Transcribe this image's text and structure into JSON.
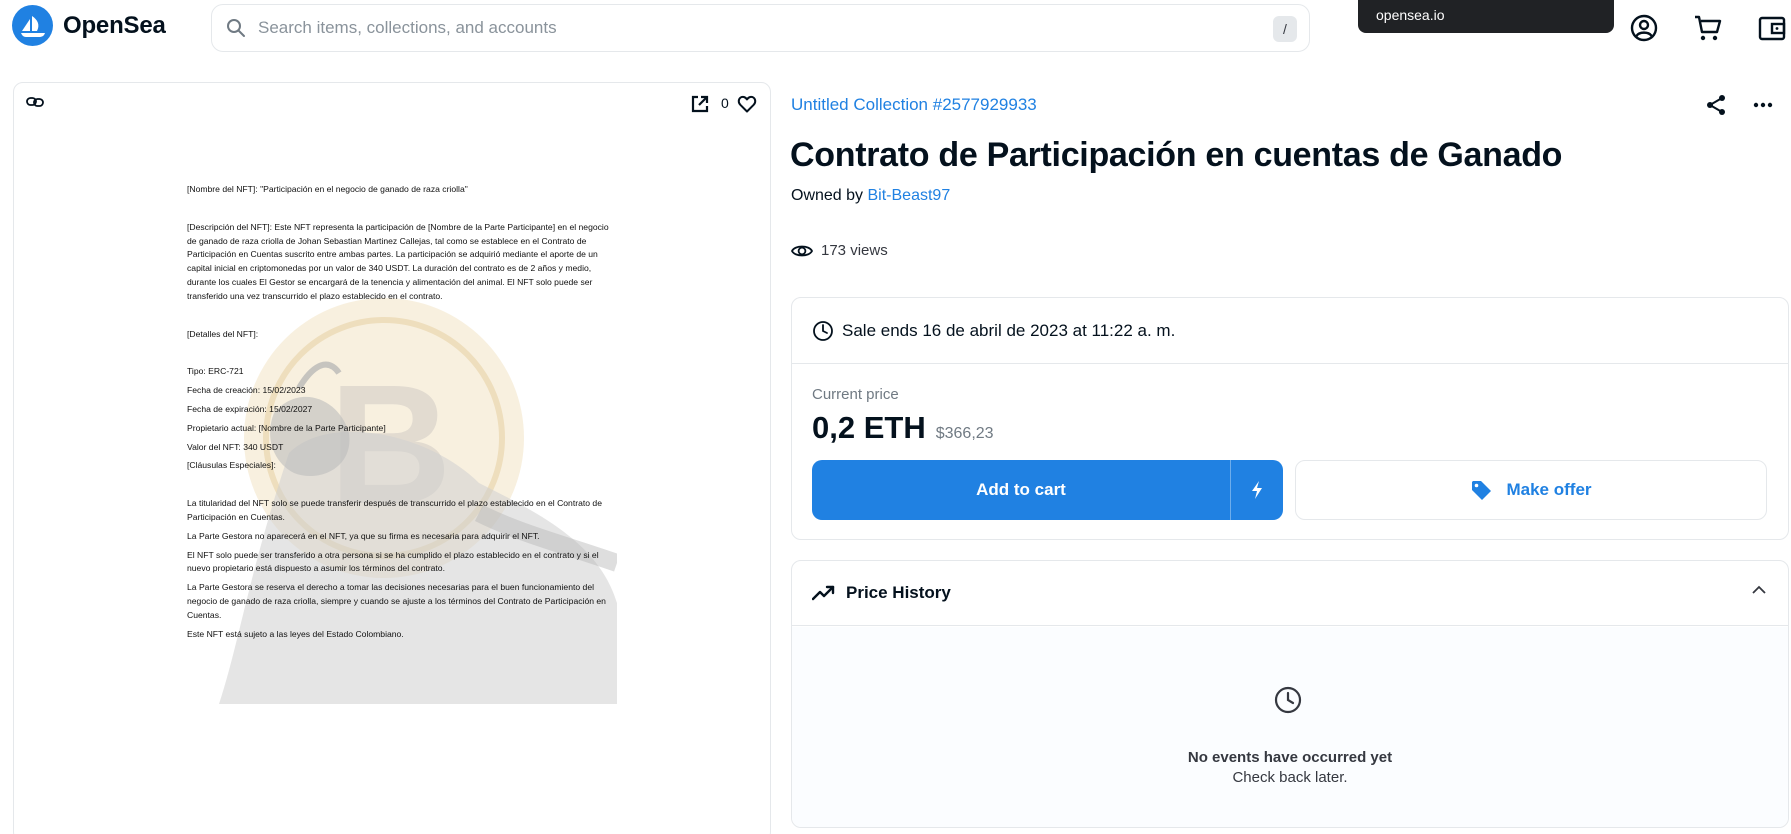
{
  "header": {
    "brand": "OpenSea",
    "search_placeholder": "Search items, collections, and accounts",
    "search_shortcut": "/",
    "tooltip": "opensea.io",
    "icons": [
      "profile-icon",
      "cart-icon",
      "wallet-icon"
    ]
  },
  "media": {
    "favorite_count": "0",
    "document": {
      "name_line": "[Nombre del NFT]: \"Participación en el negocio de ganado de raza criolla\"",
      "description": "[Descripción del NFT]: Este NFT representa la participación de [Nombre de la Parte Participante] en el negocio de ganado de raza criolla de Johan Sebastian Martinez Callejas, tal como se establece en el Contrato de Participación en Cuentas suscrito entre ambas partes. La participación se adquirió mediante el aporte de un capital inicial en criptomonedas por un valor de 340 USDT. La duración del contrato es de 2 años y medio, durante los cuales El Gestor se encargará de la tenencia y alimentación del animal. El NFT solo puede ser transferido una vez transcurrido el plazo establecido en el contrato.",
      "details_heading": "[Detalles del NFT]:",
      "type": "Tipo: ERC-721",
      "created": "Fecha de creación: 15/02/2023",
      "expires": "Fecha de expiración: 15/02/2027",
      "owner": "Propietario actual: [Nombre de la Parte Participante]",
      "value": "Valor del NFT: 340 USDT",
      "clauses_heading": "[Cláusulas Especiales]:",
      "clause_1": "La titularidad del NFT solo se puede transferir después de transcurrido el plazo establecido en el Contrato de Participación en Cuentas.",
      "clause_2": "La Parte Gestora no aparecerá en el NFT, ya que su firma es necesaria para adquirir el NFT.",
      "clause_3": "El NFT solo puede ser transferido a otra persona si se ha cumplido el plazo establecido en el contrato y si el nuevo propietario está dispuesto a asumir los términos del contrato.",
      "clause_4": "La Parte Gestora se reserva el derecho a tomar las decisiones necesarias para el buen funcionamiento del negocio de ganado de raza criolla, siempre y cuando se ajuste a los términos del Contrato de Participación en Cuentas.",
      "clause_5": "Este NFT está sujeto a las leyes del Estado Colombiano."
    }
  },
  "item": {
    "collection": "Untitled Collection #2577929933",
    "title": "Contrato de Participación en cuentas de Ganado",
    "owned_by_label": "Owned by",
    "owner": "Bit-Beast97",
    "views": "173 views"
  },
  "sale": {
    "ends": "Sale ends 16 de abril de 2023 at 11:22 a. m.",
    "current_price_label": "Current price",
    "price_eth": "0,2 ETH",
    "price_usd": "$366,23",
    "add_to_cart": "Add to cart",
    "make_offer": "Make offer"
  },
  "price_history": {
    "title": "Price History",
    "empty_title": "No events have occurred yet",
    "empty_subtitle": "Check back later."
  },
  "colors": {
    "accent": "#2081e2",
    "text": "#04111d",
    "border": "#e5e8eb"
  }
}
